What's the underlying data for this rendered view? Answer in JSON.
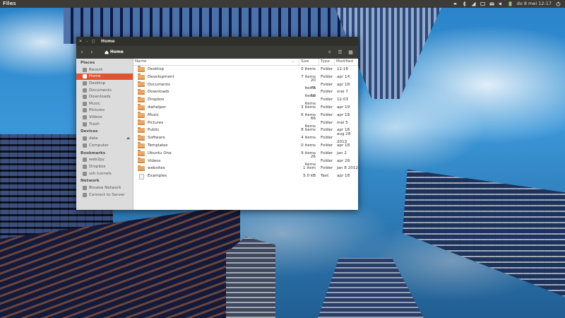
{
  "top_panel": {
    "app_title": "Files",
    "clock": "do 8 mei 12:17",
    "tray_icons": [
      "dropbox-icon",
      "bluetooth-icon",
      "network-icon",
      "keyboard-layout-icon",
      "mail-icon",
      "sound-icon",
      "battery-icon",
      "power-icon"
    ]
  },
  "window": {
    "title": "Home",
    "breadcrumb": "Home",
    "toolbar_icons": [
      "view-options-icon",
      "list-view-icon",
      "grid-view-icon"
    ]
  },
  "sidebar": {
    "sections": [
      {
        "heading": "Places",
        "items": [
          {
            "label": "Recent",
            "icon": "clock-icon"
          },
          {
            "label": "Home",
            "icon": "home-icon",
            "active": true
          },
          {
            "label": "Desktop",
            "icon": "desktop-icon"
          },
          {
            "label": "Documents",
            "icon": "documents-icon"
          },
          {
            "label": "Downloads",
            "icon": "downloads-icon"
          },
          {
            "label": "Music",
            "icon": "music-icon"
          },
          {
            "label": "Pictures",
            "icon": "pictures-icon"
          },
          {
            "label": "Videos",
            "icon": "videos-icon"
          },
          {
            "label": "Trash",
            "icon": "trash-icon"
          }
        ]
      },
      {
        "heading": "Devices",
        "items": [
          {
            "label": "data",
            "icon": "drive-icon",
            "eject": true
          },
          {
            "label": "Computer",
            "icon": "computer-icon"
          }
        ]
      },
      {
        "heading": "Bookmarks",
        "items": [
          {
            "label": "web2py",
            "icon": "folder-icon"
          },
          {
            "label": "Dropbox",
            "icon": "folder-icon"
          },
          {
            "label": "ssh tunnels",
            "icon": "folder-icon"
          }
        ]
      },
      {
        "heading": "Network",
        "items": [
          {
            "label": "Browse Network",
            "icon": "network-icon"
          },
          {
            "label": "Connect to Server",
            "icon": "server-icon"
          }
        ]
      }
    ]
  },
  "file_list": {
    "columns": {
      "name": "Name",
      "size": "Size",
      "type": "Type",
      "modified": "Modified"
    },
    "rows": [
      {
        "name": "Desktop",
        "size": "0 items",
        "type": "Folder",
        "modified": "12:16",
        "kind": "folder"
      },
      {
        "name": "Development",
        "size": "7 items",
        "type": "Folder",
        "modified": "apr 14",
        "kind": "folder"
      },
      {
        "name": "Documents",
        "size": "20 items",
        "type": "Folder",
        "modified": "apr 18",
        "kind": "folder"
      },
      {
        "name": "Downloads",
        "size": "75 items",
        "type": "Folder",
        "modified": "mei 7",
        "kind": "folder"
      },
      {
        "name": "Dropbox",
        "size": "10 items",
        "type": "Folder",
        "modified": "12:03",
        "kind": "folder"
      },
      {
        "name": "dwhelper",
        "size": "3 items",
        "type": "Folder",
        "modified": "apr 19",
        "kind": "folder"
      },
      {
        "name": "Music",
        "size": "6 items",
        "type": "Folder",
        "modified": "apr 18",
        "kind": "folder"
      },
      {
        "name": "Pictures",
        "size": "66 items",
        "type": "Folder",
        "modified": "mei 5",
        "kind": "folder"
      },
      {
        "name": "Public",
        "size": "8 items",
        "type": "Folder",
        "modified": "apr 18",
        "kind": "folder"
      },
      {
        "name": "Software",
        "size": "4 items",
        "type": "Folder",
        "modified": "aug 28 2013",
        "kind": "folder"
      },
      {
        "name": "Templates",
        "size": "0 items",
        "type": "Folder",
        "modified": "apr 18",
        "kind": "folder"
      },
      {
        "name": "Ubuntu One",
        "size": "9 items",
        "type": "Folder",
        "modified": "jan 2",
        "kind": "folder"
      },
      {
        "name": "Videos",
        "size": "26 items",
        "type": "Folder",
        "modified": "apr 28",
        "kind": "folder"
      },
      {
        "name": "websites",
        "size": "1 item",
        "type": "Folder",
        "modified": "jan 8 2012",
        "kind": "folder"
      },
      {
        "name": "Examples",
        "size": "5.0 kB",
        "type": "Text",
        "modified": "apr 18",
        "kind": "file"
      }
    ]
  },
  "colors": {
    "accent": "#e15431",
    "panel": "#3c3b37",
    "titlebar": "#2f2f2c",
    "sidebar": "#dcdcdc",
    "folder": "#e9a86a"
  }
}
